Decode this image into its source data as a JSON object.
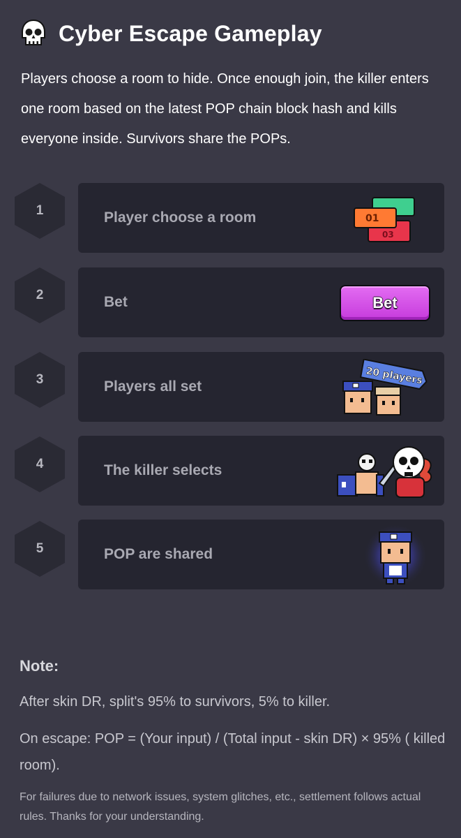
{
  "header": {
    "title": "Cyber Escape Gameplay",
    "logo_icon": "skull-icon"
  },
  "intro": "Players choose a room to hide. Once enough join, the killer enters one room based on the latest POP chain block hash and kills everyone inside. Survivors share the POPs.",
  "steps": [
    {
      "num": "1",
      "label": "Player choose a room",
      "illustration": "room-tickets-icon",
      "ticket_text": "01"
    },
    {
      "num": "2",
      "label": "Bet",
      "button_label": "Bet"
    },
    {
      "num": "3",
      "label": "Players all set",
      "illustration": "players-group-icon",
      "badge": "20 players"
    },
    {
      "num": "4",
      "label": "The killer selects",
      "illustration": "killer-attack-icon"
    },
    {
      "num": "5",
      "label": "POP are shared",
      "illustration": "survivor-glow-icon"
    }
  ],
  "note": {
    "title": "Note:",
    "line1": " After skin DR, split's 95% to survivors, 5% to killer.",
    "line2": "On escape: POP = (Your input) / (Total input - skin DR) × 95% ( killed room).",
    "disclaimer": "For failures due to network issues, system glitches, etc., settlement follows actual rules. Thanks for your understanding."
  },
  "colors": {
    "background": "#3a3946",
    "card": "#252530",
    "hexagon": "#2a2a34",
    "bet_button": "#d450e6",
    "step_text": "#a9a9b2"
  }
}
